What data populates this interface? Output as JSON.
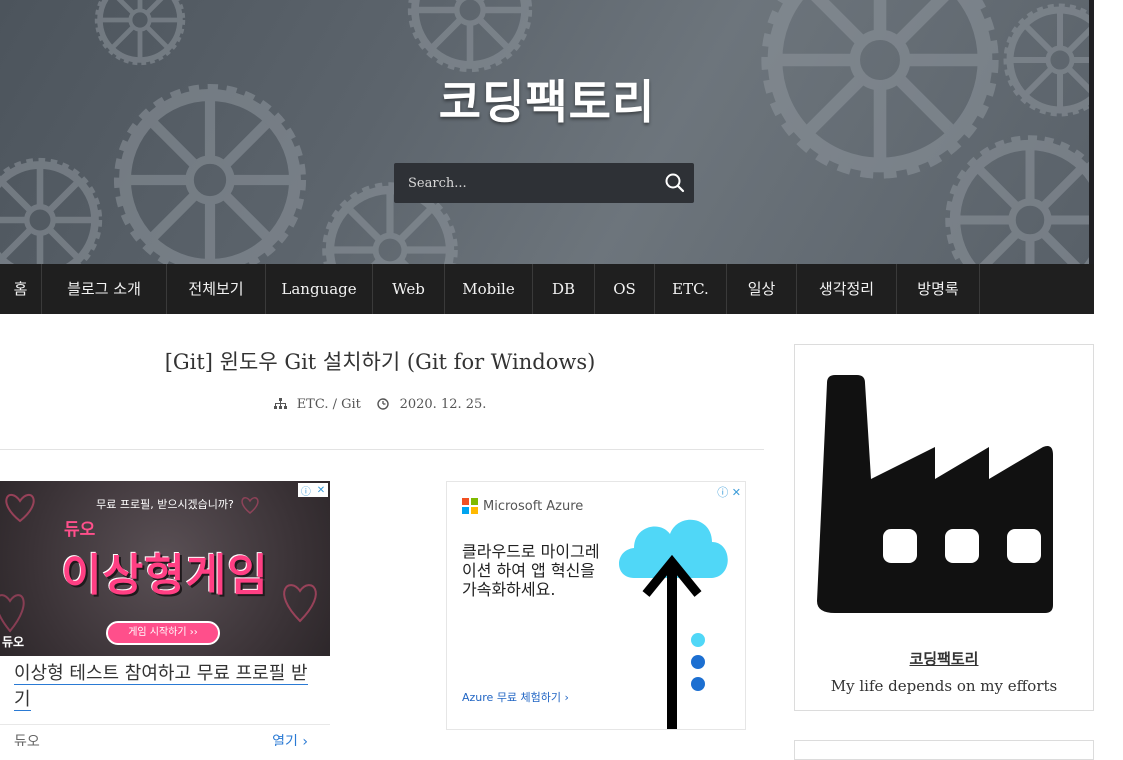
{
  "header": {
    "site_title": "코딩팩토리",
    "search_placeholder": "Search...",
    "search_icon": "search-icon"
  },
  "nav": {
    "items": [
      {
        "label": "홈"
      },
      {
        "label": "블로그 소개"
      },
      {
        "label": "전체보기"
      },
      {
        "label": "Language"
      },
      {
        "label": "Web"
      },
      {
        "label": "Mobile"
      },
      {
        "label": "DB"
      },
      {
        "label": "OS"
      },
      {
        "label": "ETC."
      },
      {
        "label": "일상"
      },
      {
        "label": "생각정리"
      },
      {
        "label": "방명록"
      }
    ]
  },
  "post": {
    "title": "[Git] 윈도우 Git 설치하기 (Git for Windows)",
    "category_main": "ETC.",
    "category_sep": "/",
    "category_sub": "Git",
    "date": "2020. 12. 25."
  },
  "ad_left": {
    "subtitle": "무료 프로필, 받으시겠습니까?",
    "brand": "듀오",
    "big_text": "이상형게임",
    "cta": "게임 시작하기 ››",
    "corner_logo": "듀오",
    "headline": "이상형 테스트 참여하고 무료 프로필 받기",
    "advertiser": "듀오",
    "open_label": "열기"
  },
  "ad_right": {
    "brand": "Microsoft Azure",
    "copy": "클라우드로 마이그레이션 하여 앱 혁신을 가속화하세요.",
    "trial": "Azure 무료 체험하기",
    "colors": [
      "#f25022",
      "#7fba00",
      "#00a4ef",
      "#ffb900"
    ]
  },
  "sidebar": {
    "profile_name": "코딩팩토리",
    "profile_bio": "My life depends on my efforts"
  }
}
